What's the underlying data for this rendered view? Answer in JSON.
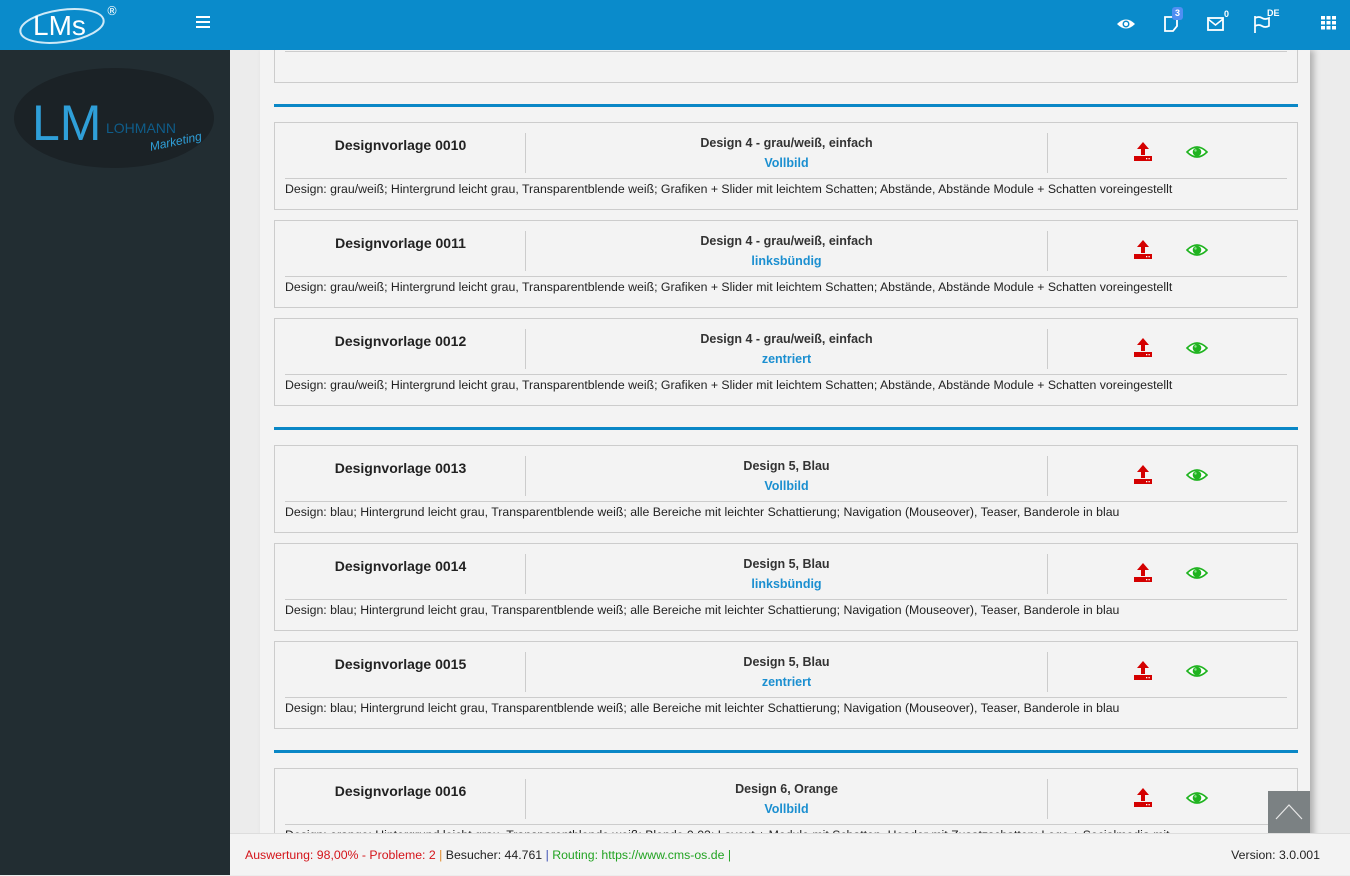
{
  "header": {
    "brand": "LMs",
    "registered": "®",
    "icons": [
      "eye-icon",
      "notes-icon",
      "mail-icon",
      "flag-icon",
      "apps-grid-icon"
    ],
    "notes_count": "3",
    "mail_count": "0",
    "language": "DE"
  },
  "sidebar": {
    "logo_text": "LOHMANN",
    "logo_sub": "Marketing"
  },
  "colors": {
    "accent": "#0a8bcb",
    "link": "#1b8fd0",
    "upload": "#d40000",
    "preview": "#1fb31f",
    "sidebar": "#222d32"
  },
  "groups": [
    {
      "cards": [
        {
          "title": "Designvorlage 0010",
          "design": "Design 4 - grau/weiß, einfach",
          "variant": "Vollbild",
          "desc": "Design: grau/weiß; Hintergrund leicht grau, Transparentblende weiß; Grafiken + Slider mit leichtem Schatten; Abstände, Abstände Module + Schatten voreingestellt"
        },
        {
          "title": "Designvorlage 0011",
          "design": "Design 4 - grau/weiß, einfach",
          "variant": "linksbündig",
          "desc": "Design: grau/weiß; Hintergrund leicht grau, Transparentblende weiß; Grafiken + Slider mit leichtem Schatten; Abstände, Abstände Module + Schatten voreingestellt"
        },
        {
          "title": "Designvorlage 0012",
          "design": "Design 4 - grau/weiß, einfach",
          "variant": "zentriert",
          "desc": "Design: grau/weiß; Hintergrund leicht grau, Transparentblende weiß; Grafiken + Slider mit leichtem Schatten; Abstände, Abstände Module + Schatten voreingestellt"
        }
      ]
    },
    {
      "cards": [
        {
          "title": "Designvorlage 0013",
          "design": "Design 5, Blau",
          "variant": "Vollbild",
          "desc": "Design: blau; Hintergrund leicht grau, Transparentblende weiß; alle Bereiche mit leichter Schattierung; Navigation (Mouseover), Teaser, Banderole in blau"
        },
        {
          "title": "Designvorlage 0014",
          "design": "Design 5, Blau",
          "variant": "linksbündig",
          "desc": "Design: blau; Hintergrund leicht grau, Transparentblende weiß; alle Bereiche mit leichter Schattierung; Navigation (Mouseover), Teaser, Banderole in blau"
        },
        {
          "title": "Designvorlage 0015",
          "design": "Design 5, Blau",
          "variant": "zentriert",
          "desc": "Design: blau; Hintergrund leicht grau, Transparentblende weiß; alle Bereiche mit leichter Schattierung; Navigation (Mouseover), Teaser, Banderole in blau"
        }
      ]
    },
    {
      "cards": [
        {
          "title": "Designvorlage 0016",
          "design": "Design 6, Orange",
          "variant": "Vollbild",
          "desc": "Design: orange; Hintergrund leicht grau, Transparentblende weiß; Blende 0,02; Layout + Module mit Schatten, Header mit Zusatzschatten; Logo + Socialmedia mit"
        }
      ]
    }
  ],
  "footer": {
    "auswertung": "Auswertung: 98,00% - Probleme: 2",
    "besucher": "Besucher: 44.761",
    "routing_label": "Routing: ",
    "routing_url": "https://www.cms-os.de",
    "version": "Version: 3.0.001"
  }
}
